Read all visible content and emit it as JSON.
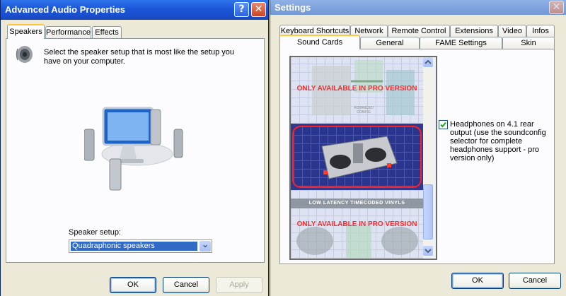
{
  "left_window": {
    "title": "Advanced Audio Properties",
    "help_glyph": "?",
    "close_glyph": "✕",
    "tabs": [
      "Speakers",
      "Performance",
      "Effects"
    ],
    "instruction": "Select the speaker setup that is most like the setup you have on your computer.",
    "speaker_setup_label": "Speaker setup:",
    "speaker_setup_value": "Quadraphonic speakers",
    "dropdown_arrow": "⌄",
    "buttons": {
      "ok": "OK",
      "cancel": "Cancel",
      "apply": "Apply"
    }
  },
  "right_window": {
    "title": "Settings",
    "close_glyph": "✕",
    "tabs_row1": [
      "Keyboard Shortcuts",
      "Network",
      "Remote Control",
      "Extensions",
      "Video",
      "Infos"
    ],
    "tabs_row2": [
      "Sound Cards",
      "General",
      "FAME Settings",
      "Skin"
    ],
    "pro_banner_top": "ONLY AVAILABLE IN PRO VERSION",
    "advanced_config_label": "ADVANCED CONFIG",
    "low_latency_label": "LOW LATENCY TIMECODED VINYLS",
    "pro_banner_bottom": "ONLY AVAILABLE IN PRO VERSION",
    "checkbox": {
      "checked": true,
      "label": "Headphones on 4.1 rear output (use the soundconfig selector for complete headphones support - pro version only)"
    },
    "buttons": {
      "ok": "OK",
      "cancel": "Cancel"
    }
  },
  "colors": {
    "xp_blue": "#1c56d8",
    "pro_red": "#ff2a2a",
    "selection": "#316ac5"
  }
}
